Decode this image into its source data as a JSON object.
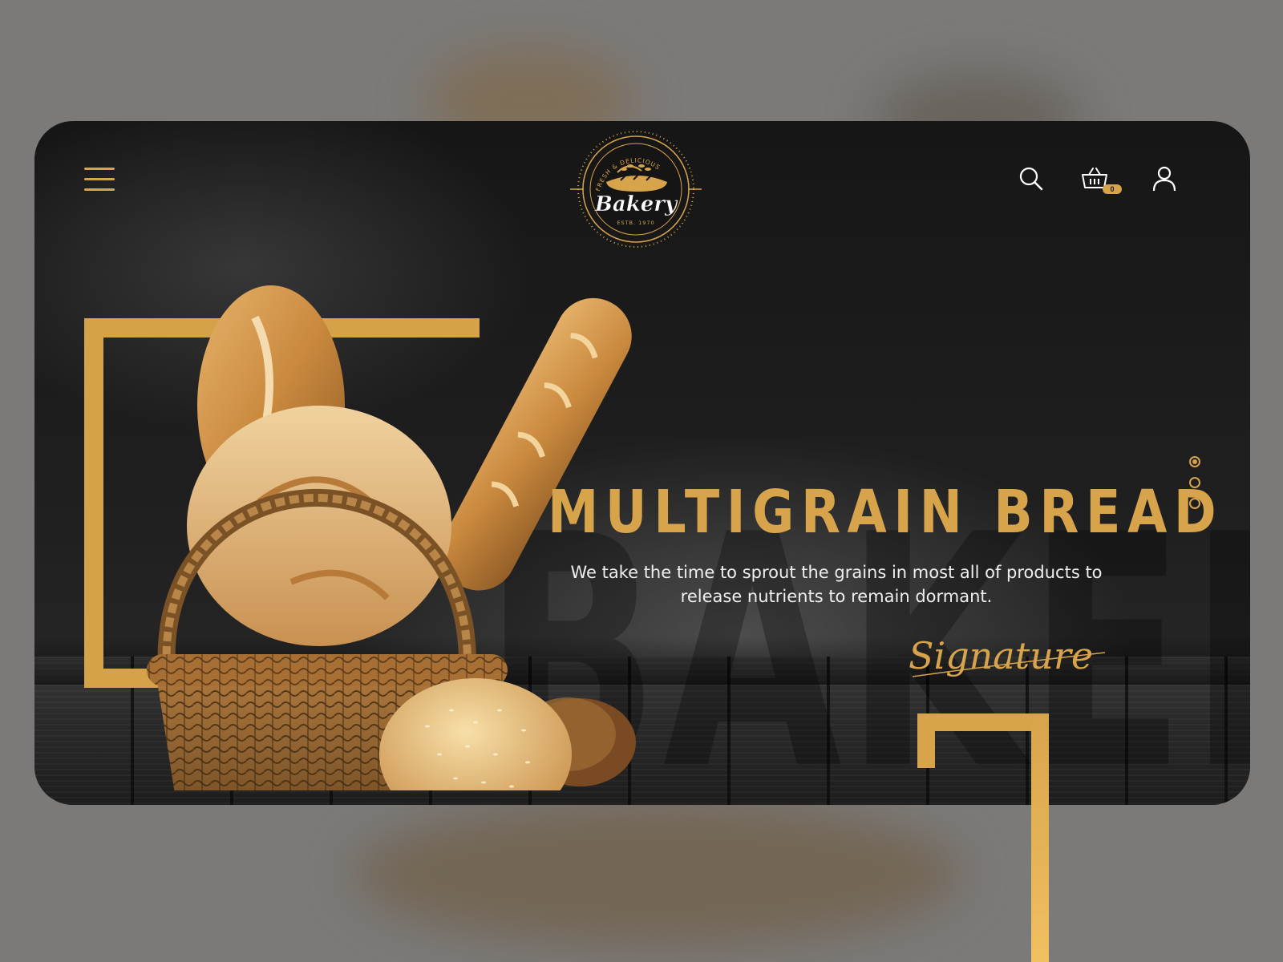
{
  "logo": {
    "text": "Bakery",
    "ring_text": "FRESH & DELICIOUS",
    "established": "ESTB. 1970"
  },
  "header": {
    "menu_icon": "hamburger-menu-icon",
    "search_icon": "search-icon",
    "cart_icon": "shopping-basket-icon",
    "cart_count": "0",
    "user_icon": "user-icon"
  },
  "hero": {
    "background_word": "BAKERY",
    "title": "MULTIGRAIN BREAD",
    "description": "We take the time to sprout the grains in most all of products to release nutrients to remain dormant.",
    "signature": "Signature",
    "slides": [
      {
        "active": true
      },
      {
        "active": false
      },
      {
        "active": false
      }
    ]
  },
  "colors": {
    "accent": "#d7a44b",
    "background": "#1c1c1c",
    "page_backdrop": "#7b7a79",
    "text": "#efefef"
  }
}
